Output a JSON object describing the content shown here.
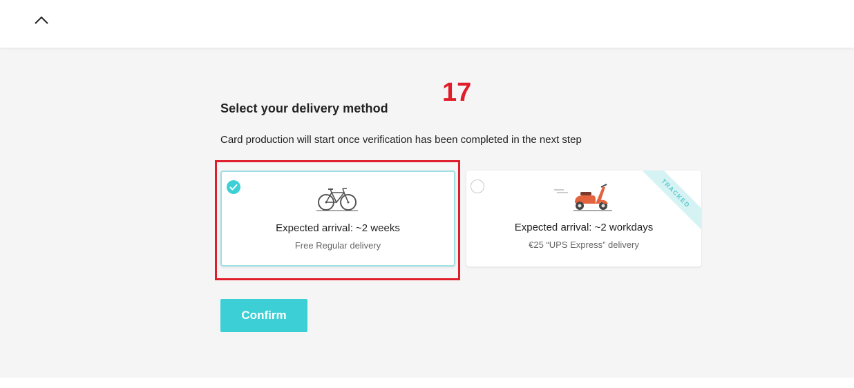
{
  "header": {
    "collapse_icon": "chevron-up-icon"
  },
  "annotation": {
    "step_number": "17",
    "highlight_color": "#e01e2b"
  },
  "page": {
    "title": "Select your delivery method",
    "subtitle": "Card production will start once verification has been completed in the next step"
  },
  "options": [
    {
      "icon": "bicycle-icon",
      "arrival": "Expected arrival: ~2 weeks",
      "method": "Free Regular delivery",
      "selected": true
    },
    {
      "icon": "scooter-icon",
      "arrival": "Expected arrival: ~2 workdays",
      "method": "€25 “UPS Express” delivery",
      "selected": false,
      "badge": "TRACKED"
    }
  ],
  "actions": {
    "confirm_label": "Confirm"
  },
  "colors": {
    "accent": "#3ccfd6",
    "selected_border": "#9ee0e3",
    "background": "#f5f5f5"
  }
}
